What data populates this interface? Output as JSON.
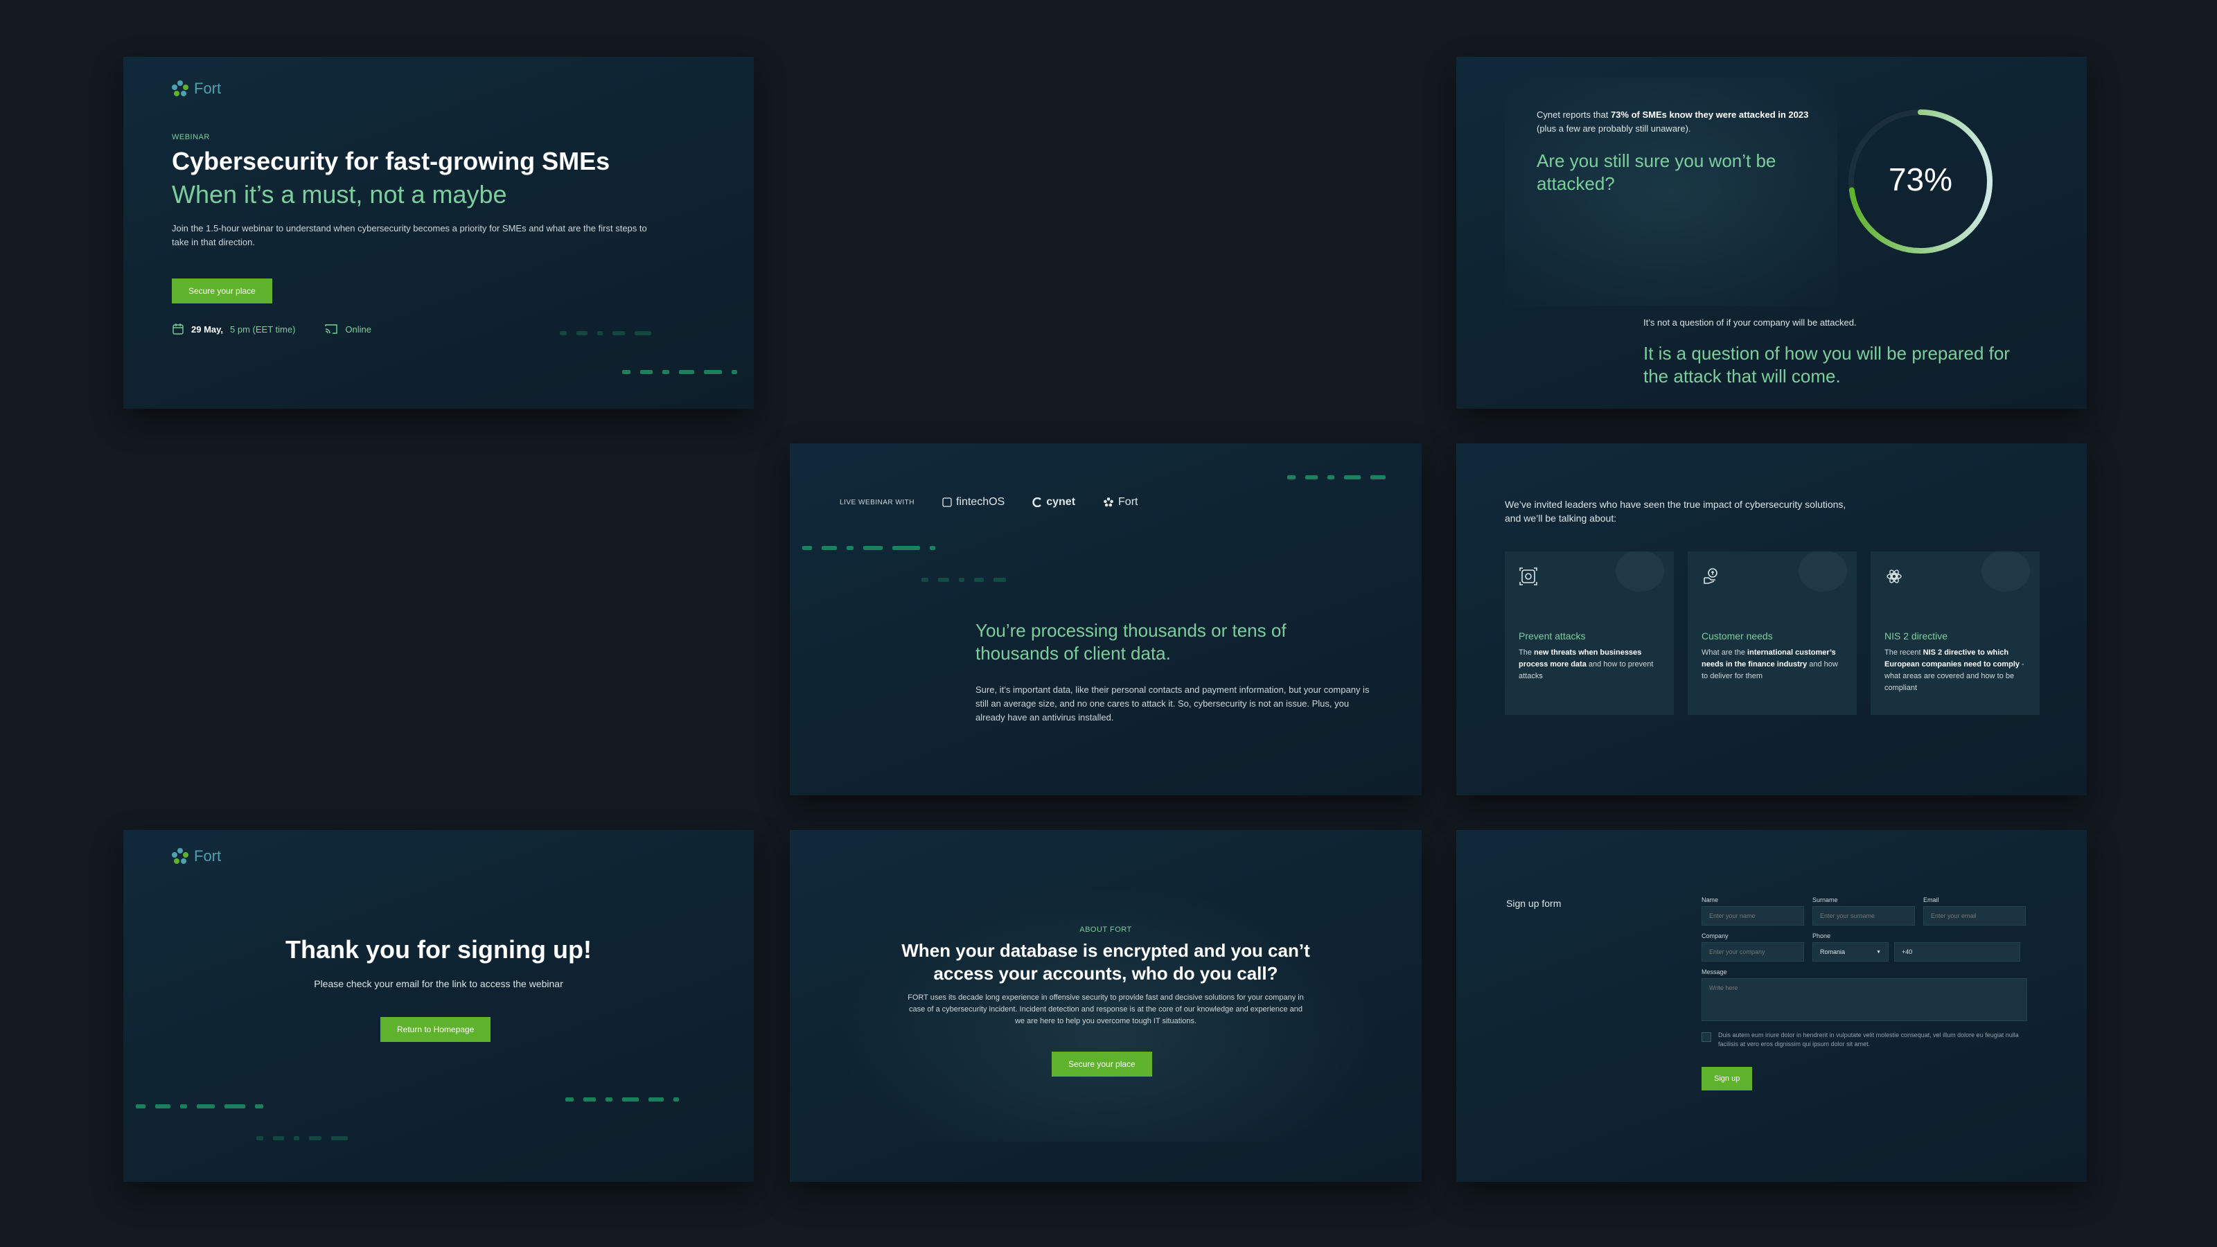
{
  "hero": {
    "brand": "Fort",
    "tag": "WEBINAR",
    "title": "Cybersecurity for fast-growing SMEs",
    "subtitle": "When it’s a must, not a maybe",
    "description": "Join the 1.5-hour webinar to understand when cybersecurity becomes a priority for SMEs and what are the first steps to take in that direction.",
    "cta": "Secure your place",
    "date": "29 May,",
    "time": "5 pm (EET time)",
    "location": "Online"
  },
  "stats": {
    "lead_1": "Cynet reports that ",
    "lead_bold": "73% of SMEs know they were attacked in 2023",
    "lead_2": " (plus a few are probably still unaware).",
    "question": "Are you still sure you won’t be attacked?",
    "percent_label": "73%",
    "percent_value": 73,
    "note": "It’s not a question of if your company will be attacked.",
    "statement": "It is a question of how you will be prepared for the attack that will come."
  },
  "partners": {
    "label": "LIVE WEBINAR WITH",
    "items": [
      "fintechOS",
      "cynet",
      "Fort"
    ],
    "headline": "You’re processing thousands or tens of thousands of client data.",
    "body": "Sure, it’s important data, like their personal contacts and payment information, but your company is still an average size, and no one cares to attack it. So, cybersecurity is not an issue. Plus, you already have an antivirus installed."
  },
  "topics": {
    "intro": "We’ve invited leaders who have seen the true impact of cybersecurity solutions, and we’ll be talking about:",
    "items": [
      {
        "icon": "shield-target-icon",
        "title": "Prevent attacks",
        "t1": "The ",
        "b1": "new threats when businesses process more data",
        "t2": " and how to prevent attacks"
      },
      {
        "icon": "hand-coin-icon",
        "title": "Customer needs",
        "t1": "What are the ",
        "b1": "international customer’s needs in the finance industry",
        "t2": " and how to deliver for them"
      },
      {
        "icon": "atom-gear-icon",
        "title": "NIS 2 directive",
        "t1": "The recent ",
        "b1": "NIS 2 directive to which European companies need to comply",
        "t2": " - what areas are covered and how to be compliant"
      }
    ]
  },
  "thanks": {
    "brand": "Fort",
    "title": "Thank you for signing up!",
    "subtitle": "Please check your email for the link to access the webinar",
    "cta": "Return to Homepage"
  },
  "about": {
    "tag": "ABOUT FORT",
    "title": "When your database is encrypted and you can’t access your accounts, who do you call?",
    "body": "FORT uses its decade long experience in offensive security to provide fast and decisive solutions for your company in case of a cybersecurity incident. Incident detection and response is at the core of our knowledge and experience and we are here to help you overcome tough IT situations.",
    "cta": "Secure your place"
  },
  "form": {
    "title": "Sign up form",
    "name_label": "Name",
    "name_ph": "Enter your name",
    "surname_label": "Surname",
    "surname_ph": "Enter your surname",
    "email_label": "Email",
    "email_ph": "Enter your email",
    "company_label": "Company",
    "company_ph": "Enter your company",
    "phone_label": "Phone",
    "country": "Romania",
    "prefix": "+40",
    "message_label": "Message",
    "message_ph": "Write here",
    "consent": "Duis autem eum iriure dolor in hendrerit in vulputate velit molestie consequat, vel illum dolore eu feugiat nulla facilisis at vero eros dignissim qui ipsum dolor sit amet.",
    "submit": "Sign up"
  },
  "colors": {
    "accent": "#5fb32c",
    "mint": "#7ccf9d",
    "bg": "#13191f",
    "card": "#0f2330"
  }
}
